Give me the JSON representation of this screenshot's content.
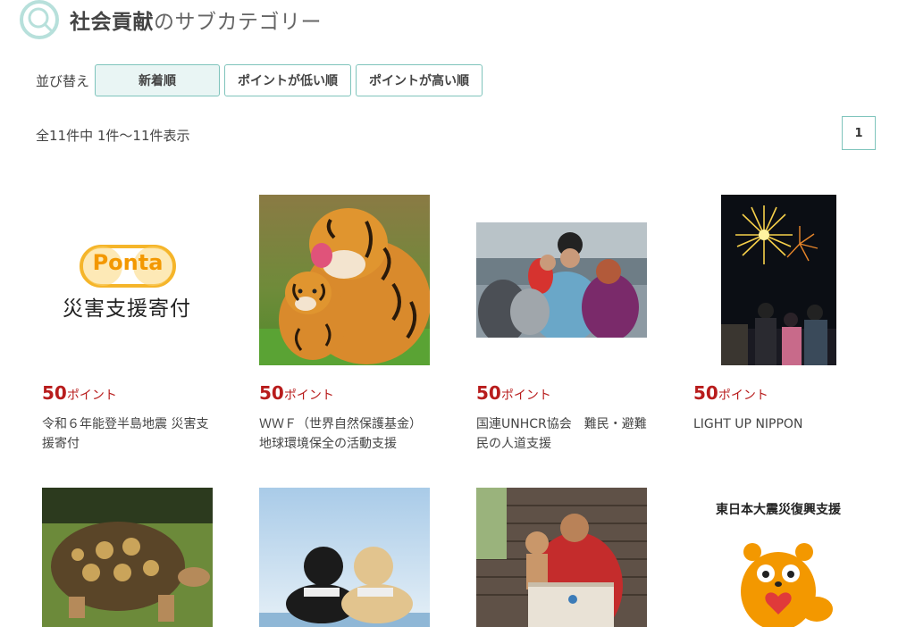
{
  "header": {
    "title_strong": "社会貢献",
    "title_rest": "のサブカテゴリー"
  },
  "sort": {
    "label": "並び替え",
    "options": [
      "新着順",
      "ポイントが低い順",
      "ポイントが高い順"
    ],
    "active": "新着順"
  },
  "results": {
    "count_text": "全11件中 1件〜11件表示",
    "page": "1"
  },
  "cards": [
    {
      "points": "50",
      "unit": "ポイント",
      "title": "令和６年能登半島地震 災害支援寄付",
      "image": "ponta-logo",
      "logo_text": "Ponta",
      "caption": "災害支援寄付"
    },
    {
      "points": "50",
      "unit": "ポイント",
      "title": "ＷＷＦ（世界自然保護基金） 地球環境保全の活動支援",
      "image": "tiger-photo"
    },
    {
      "points": "50",
      "unit": "ポイント",
      "title": "国連UNHCR協会　難民・避難民の人道支援",
      "image": "refugee-photo"
    },
    {
      "points": "50",
      "unit": "ポイント",
      "title": "LIGHT UP NIPPON",
      "image": "fireworks-photo"
    },
    {
      "image": "tortoise-photo"
    },
    {
      "image": "guide-dogs-photo"
    },
    {
      "image": "mother-child-photo"
    },
    {
      "image": "tohoku-mascot",
      "caption": "東日本大震災復興支援"
    }
  ],
  "colors": {
    "accent": "#7fc4bc",
    "points": "#b81c1c",
    "ponta_orange": "#f39800"
  }
}
